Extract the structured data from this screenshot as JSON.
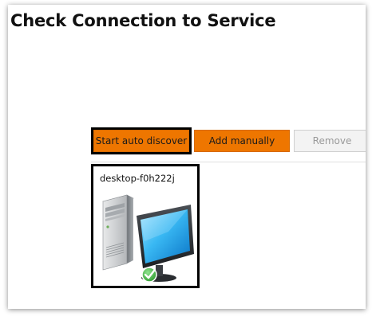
{
  "page": {
    "title": "Check Connection to Service"
  },
  "toolbar": {
    "auto_discover_label": "Start auto discover",
    "add_manually_label": "Add manually",
    "remove_label": "Remove"
  },
  "devices": [
    {
      "name": "desktop-f0h222j",
      "icon": "desktop-computer-icon",
      "status_icon": "connected-checkmark-icon",
      "status_color": "#3fae3f"
    }
  ],
  "colors": {
    "accent": "#ee7600",
    "focus_border": "#000000",
    "disabled_bg": "#f3f3f3"
  }
}
